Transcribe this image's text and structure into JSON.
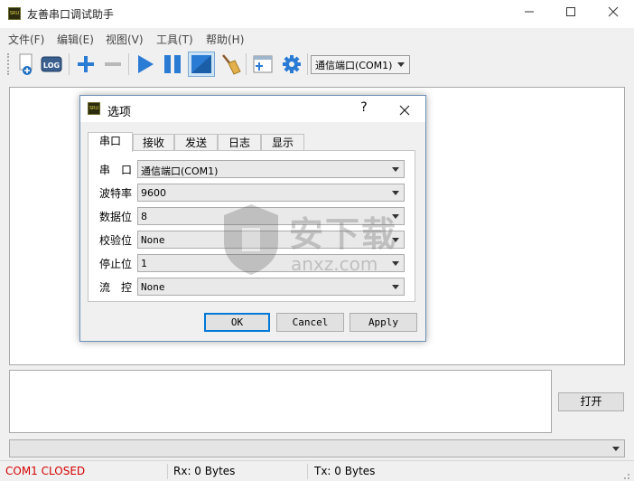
{
  "window": {
    "title": "友善串口调试助手",
    "logo_text": "SRU"
  },
  "menubar": [
    "文件(F)",
    "编辑(E)",
    "视图(V)",
    "工具(T)",
    "帮助(H)"
  ],
  "toolbar": {
    "log_label": "LOG",
    "port_select": "通信端口(COM1)",
    "icons": [
      "new-icon",
      "log-icon",
      "add-icon",
      "remove-icon",
      "play-icon",
      "pause-icon",
      "display-mode-icon",
      "broom-icon",
      "window-add-icon",
      "gear-icon"
    ]
  },
  "send": {
    "open_button": "打开"
  },
  "status": {
    "port_state": "COM1 CLOSED",
    "port_state_color": "#d40000",
    "rx": "Rx: 0 Bytes",
    "tx": "Tx: 0 Bytes"
  },
  "dialog": {
    "title": "选项",
    "help": "?",
    "tabs": [
      "串口",
      "接收",
      "发送",
      "日志",
      "显示"
    ],
    "active_tab": 0,
    "fields": [
      {
        "label": "串　口",
        "value": "通信端口(COM1)"
      },
      {
        "label": "波特率",
        "value": "9600"
      },
      {
        "label": "数据位",
        "value": "8"
      },
      {
        "label": "校验位",
        "value": "None"
      },
      {
        "label": "停止位",
        "value": "1"
      },
      {
        "label": "流　控",
        "value": "None"
      }
    ],
    "buttons": {
      "ok": "OK",
      "cancel": "Cancel",
      "apply": "Apply"
    }
  },
  "watermark": {
    "text": "安下载",
    "domain": "anxz.com"
  },
  "colors": {
    "accent": "#0078d7",
    "toolbar_blue": "#2a7bd4"
  }
}
